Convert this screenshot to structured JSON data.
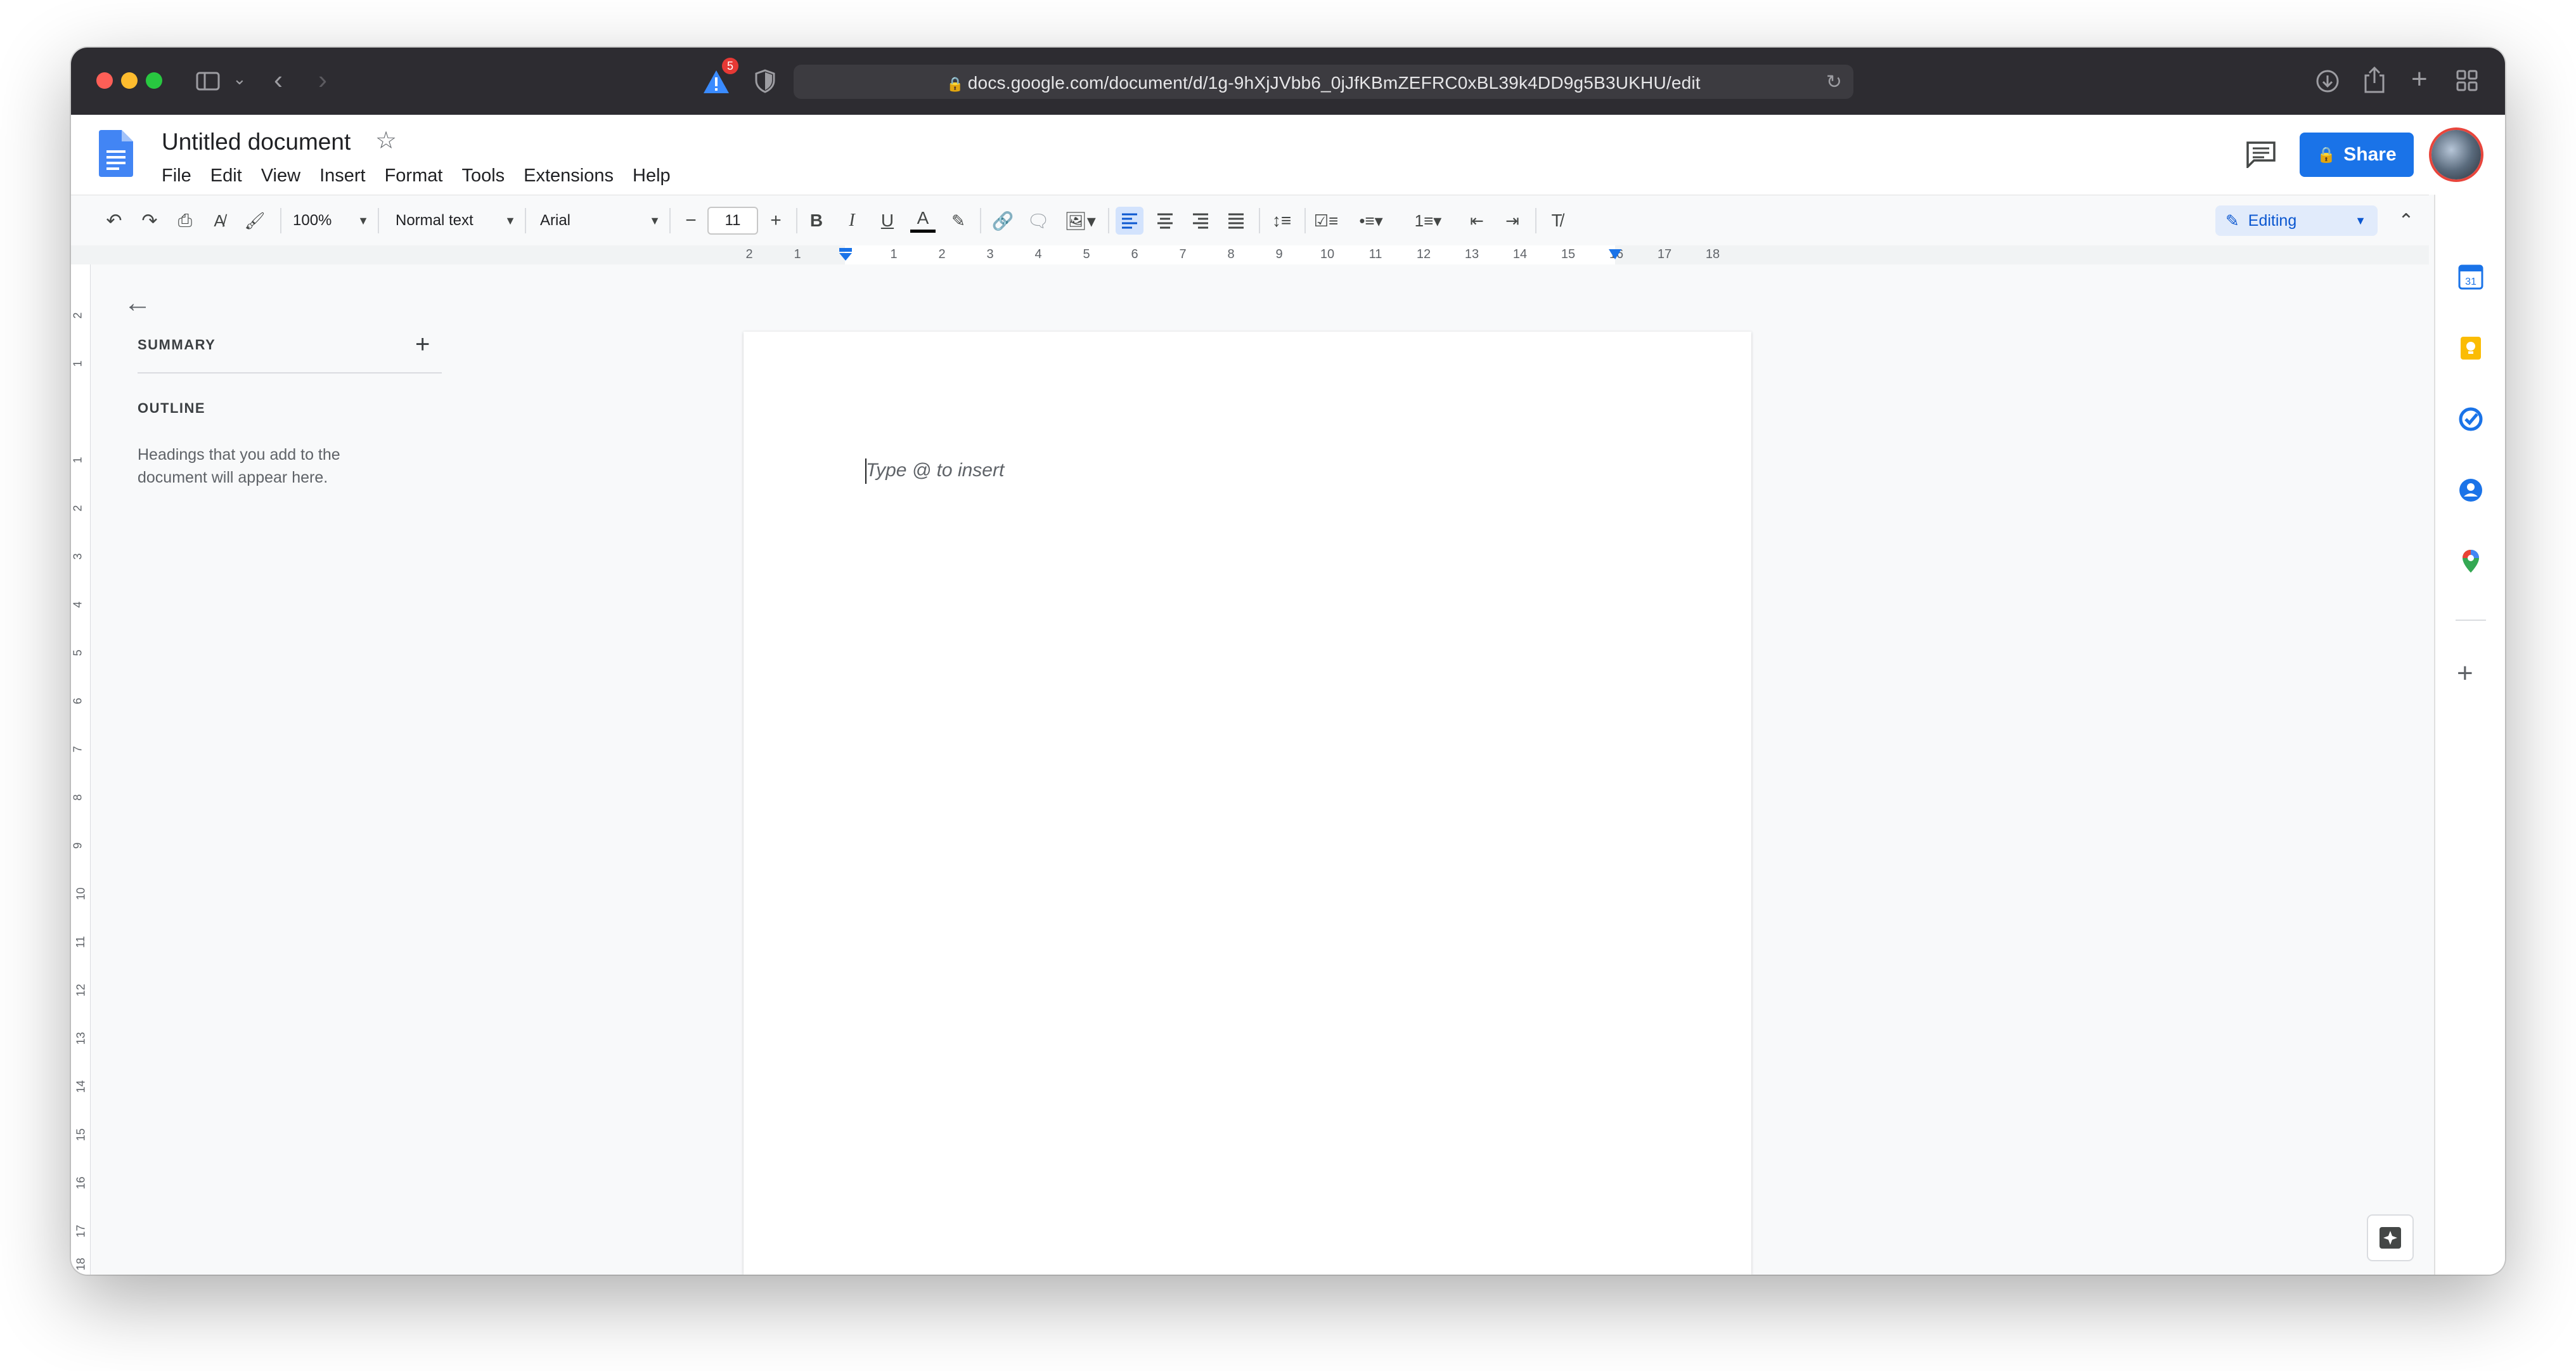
{
  "browser": {
    "url": "docs.google.com/document/d/1g-9hXjJVbb6_0jJfKBmZEFRC0xBL39k4DD9g5B3UKHU/edit",
    "alert_badge_count": "5"
  },
  "header": {
    "doc_title": "Untitled document",
    "menu": [
      "File",
      "Edit",
      "View",
      "Insert",
      "Format",
      "Tools",
      "Extensions",
      "Help"
    ],
    "share_label": "Share"
  },
  "toolbar": {
    "zoom": "100%",
    "style": "Normal text",
    "font": "Arial",
    "font_size": "11",
    "mode": "Editing"
  },
  "ruler": {
    "h_numbers": [
      "2",
      "1",
      "1",
      "2",
      "3",
      "4",
      "5",
      "6",
      "7",
      "8",
      "9",
      "10",
      "11",
      "12",
      "13",
      "14",
      "15",
      "16",
      "17",
      "18"
    ],
    "v_numbers": [
      "2",
      "1",
      "1",
      "2",
      "3",
      "4",
      "5",
      "6",
      "7",
      "8",
      "9",
      "10",
      "11",
      "12",
      "13",
      "14",
      "15",
      "16",
      "17",
      "18"
    ]
  },
  "outline_panel": {
    "summary_label": "SUMMARY",
    "outline_label": "OUTLINE",
    "hint": "Headings that you add to the document will appear here."
  },
  "document": {
    "placeholder": "Type @ to insert"
  },
  "colors": {
    "accent": "#1a73e8",
    "titlebar": "#2d2c31"
  }
}
